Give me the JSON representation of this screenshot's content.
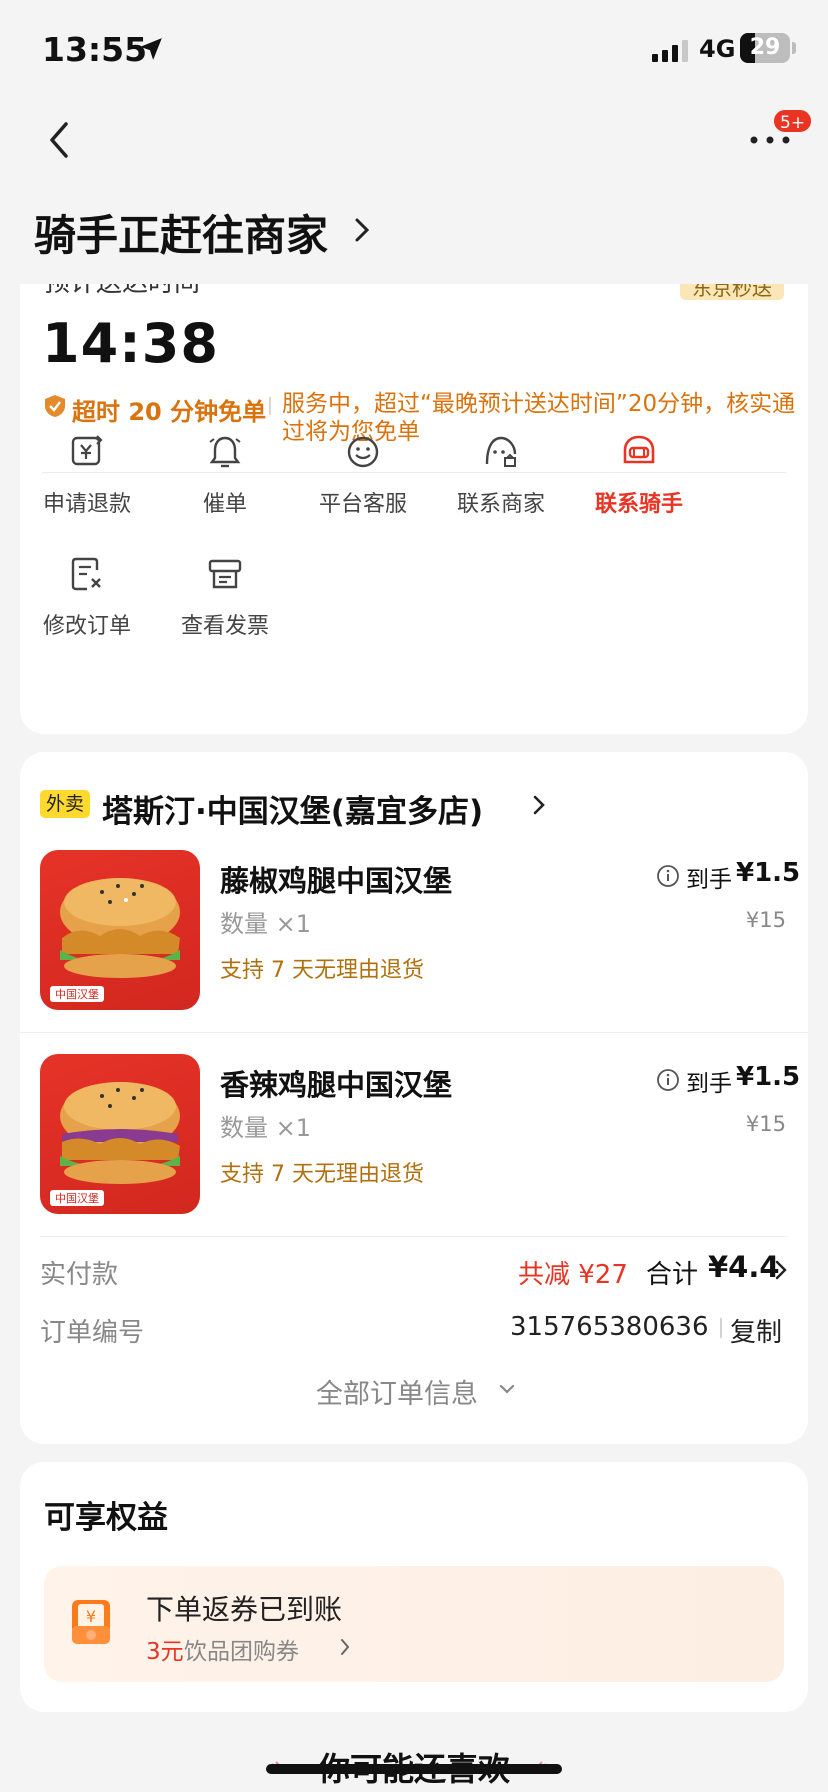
{
  "status_bar": {
    "time": "13:55",
    "network": "4G",
    "battery": "29"
  },
  "nav": {
    "badge": "5+"
  },
  "page": {
    "title": "骑手正赶往商家"
  },
  "delivery": {
    "clipped_label": "预计送达时间",
    "clipped_tag": "东京秒送",
    "eta": "14:38",
    "promise_label": "超时 20 分钟免单",
    "promise_desc": "服务中，超过“最晚预计送达时间”20分钟，核实通过将为您免单",
    "actions": [
      {
        "label": "申请退款",
        "icon": "refund-icon"
      },
      {
        "label": "催单",
        "icon": "bell-icon"
      },
      {
        "label": "平台客服",
        "icon": "service-icon"
      },
      {
        "label": "联系商家",
        "icon": "merchant-icon"
      },
      {
        "label": "联系骑手",
        "icon": "rider-icon"
      },
      {
        "label": "修改订单",
        "icon": "edit-order-icon"
      },
      {
        "label": "查看发票",
        "icon": "invoice-icon"
      }
    ],
    "accent_color": "#e93323",
    "promise_color": "#d9730d"
  },
  "order": {
    "shop_tag": "外卖",
    "shop_name": "塔斯汀·中国汉堡(嘉宜多店)",
    "items": [
      {
        "name": "藤椒鸡腿中国汉堡",
        "qty": "数量 ×1",
        "return_policy": "支持 7 天无理由退货",
        "final_label": "到手",
        "final_price": "¥1.5",
        "orig_price": "¥15",
        "image_tag": "中国汉堡"
      },
      {
        "name": "香辣鸡腿中国汉堡",
        "qty": "数量 ×1",
        "return_policy": "支持 7 天无理由退货",
        "final_label": "到手",
        "final_price": "¥1.5",
        "orig_price": "¥15",
        "image_tag": "中国汉堡"
      }
    ],
    "paid_label": "实付款",
    "discount": "共减 ¥27",
    "total_label": "合计",
    "total_value": "¥4.4",
    "order_no_label": "订单编号",
    "order_no": "315765380636",
    "copy": "复制",
    "all_info": "全部订单信息"
  },
  "benefits": {
    "title": "可享权益",
    "main": "下单返券已到账",
    "amount": "3元",
    "sub": "饮品团购券"
  },
  "recommend": {
    "title": "你可能还喜欢"
  }
}
